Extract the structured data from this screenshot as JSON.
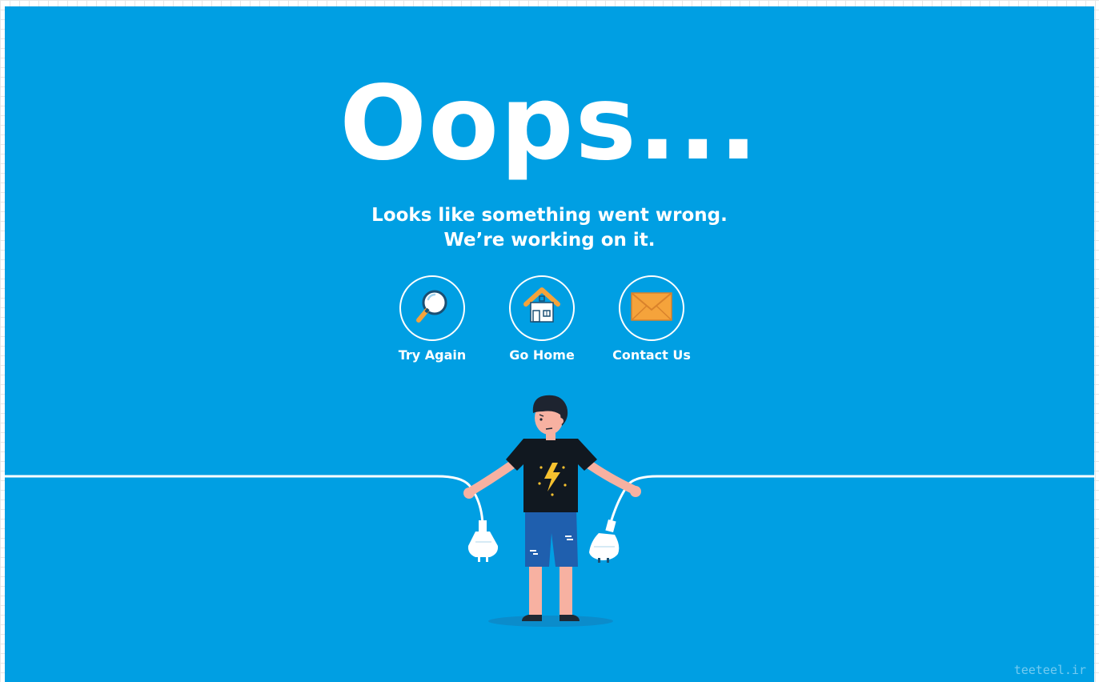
{
  "error": {
    "title": "Oops...",
    "message_line1": "Looks like something went wrong.",
    "message_line2": "We’re working on it."
  },
  "actions": [
    {
      "label": "Try Again",
      "icon": "magnifier-icon"
    },
    {
      "label": "Go Home",
      "icon": "house-icon"
    },
    {
      "label": "Contact Us",
      "icon": "envelope-icon"
    }
  ],
  "watermark": "teeteel.ir",
  "colors": {
    "background": "#009fe3",
    "text": "#ffffff",
    "accent_orange": "#f5a33b"
  }
}
